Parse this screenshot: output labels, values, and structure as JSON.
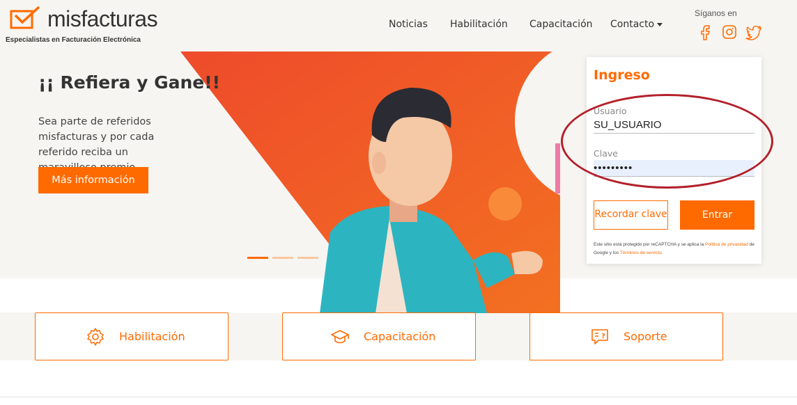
{
  "brand": {
    "name": "misfacturas",
    "tagline": "Especialistas en Facturación Electrónica",
    "accent": "#ff6a00"
  },
  "nav": {
    "items": [
      "Noticias",
      "Habilitación",
      "Capacitación",
      "Contacto"
    ]
  },
  "social": {
    "label": "Síganos en",
    "icons": [
      "facebook-icon",
      "instagram-icon",
      "twitter-icon"
    ]
  },
  "hero": {
    "title": "¡¡ Refiera y Gane!!",
    "text": "Sea parte de referidos misfacturas y por cada referido reciba un maravilloso premio.",
    "button": "Más información",
    "slides": 3,
    "active_slide": 1
  },
  "login": {
    "title": "Ingreso",
    "user_label": "Usuario",
    "user_value": "SU_USUARIO",
    "password_label": "Clave",
    "password_value": "•••••••••",
    "recover_button": "Recordar clave",
    "submit_button": "Entrar",
    "recaptcha_text_1": "Este sitio está protegido por reCAPTCHA y se aplica la ",
    "recaptcha_link_1": "Política de privacidad",
    "recaptcha_text_2": " de Google y los ",
    "recaptcha_link_2": "Términos de servicio",
    "recaptcha_text_3": "."
  },
  "features": [
    {
      "label": "Habilitación",
      "icon": "gear-icon"
    },
    {
      "label": "Capacitación",
      "icon": "graduation-cap-icon"
    },
    {
      "label": "Soporte",
      "icon": "help-chat-icon"
    }
  ],
  "annotation_color": "#b3202a"
}
